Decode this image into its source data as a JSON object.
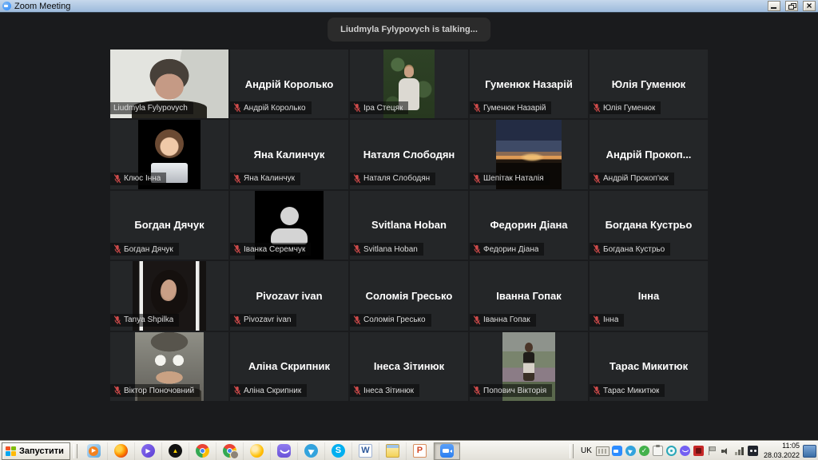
{
  "window": {
    "title": "Zoom Meeting",
    "controls": {
      "minimize": "minimize",
      "restore": "restore",
      "close": "close"
    }
  },
  "toast": {
    "text": "Liudmyla Fylypovych is talking..."
  },
  "meeting": {
    "participants": [
      {
        "label": "Liudmyla Fylypovych",
        "type": "video",
        "avatar": "liudmyla",
        "muted": false,
        "active": true
      },
      {
        "label": "Андрій Королько",
        "type": "text",
        "display_name": "Андрій Королько",
        "muted": true
      },
      {
        "label": "Іра Стецяк",
        "type": "avatar",
        "avatar": "ira",
        "muted": true
      },
      {
        "label": "Гуменюк Назарій",
        "type": "text",
        "display_name": "Гуменюк Назарій",
        "muted": true
      },
      {
        "label": "Юлія Гуменюк",
        "type": "text",
        "display_name": "Юлія Гуменюк",
        "muted": true
      },
      {
        "label": "Клюс Інна",
        "type": "avatar",
        "avatar": "klius",
        "muted": true
      },
      {
        "label": "Яна Калинчук",
        "type": "text",
        "display_name": "Яна Калинчук",
        "muted": true
      },
      {
        "label": "Наталя Слободян",
        "type": "text",
        "display_name": "Наталя Слободян",
        "muted": true
      },
      {
        "label": "Шепітак Наталія",
        "type": "avatar",
        "avatar": "sunset",
        "muted": true
      },
      {
        "label": "Андрій Прокоп'юк",
        "type": "text",
        "display_name": "Андрій  Прокоп...",
        "muted": true
      },
      {
        "label": "Богдан Дячук",
        "type": "text",
        "display_name": "Богдан Дячук",
        "muted": true
      },
      {
        "label": "Іванка Серемчук",
        "type": "avatar",
        "avatar": "placeholder",
        "muted": true
      },
      {
        "label": "Svitlana Hoban",
        "type": "text",
        "display_name": "Svitlana Hoban",
        "muted": true
      },
      {
        "label": "Федорин Діана",
        "type": "text",
        "display_name": "Федорин Діана",
        "muted": true
      },
      {
        "label": "Богдана Кустрьо",
        "type": "text",
        "display_name": "Богдана Кустрьо",
        "muted": true
      },
      {
        "label": "Tanya Shpilka",
        "type": "avatar",
        "avatar": "tanya",
        "muted": true
      },
      {
        "label": "Pivozavr ivan",
        "type": "text",
        "display_name": "Pivozavr ivan",
        "muted": true
      },
      {
        "label": "Соломія Гресько",
        "type": "text",
        "display_name": "Соломія Гресько",
        "muted": true
      },
      {
        "label": "Іванна Гопак",
        "type": "text",
        "display_name": "Іванна Гопак",
        "muted": true
      },
      {
        "label": "Інна",
        "type": "text",
        "display_name": "Інна",
        "muted": true
      },
      {
        "label": "Віктор Поночовний",
        "type": "avatar",
        "avatar": "viktor",
        "muted": true
      },
      {
        "label": "Аліна Скрипник",
        "type": "text",
        "display_name": "Аліна Скрипник",
        "muted": true
      },
      {
        "label": "Інеса Зітинюк",
        "type": "text",
        "display_name": "Інеса Зітинюк",
        "muted": true
      },
      {
        "label": "Попович Вікторія",
        "type": "avatar",
        "avatar": "popovych",
        "muted": true
      },
      {
        "label": "Тарас Микитюк",
        "type": "text",
        "display_name": "Тарас Микитюк",
        "muted": true
      }
    ]
  },
  "taskbar": {
    "start_label": "Запустити",
    "apps": [
      {
        "id": "wmp",
        "name": "windows-media-player"
      },
      {
        "id": "firefox",
        "name": "firefox"
      },
      {
        "id": "kmplayer",
        "name": "kmplayer"
      },
      {
        "id": "aimp",
        "name": "aimp"
      },
      {
        "id": "chrome",
        "name": "google-chrome"
      },
      {
        "id": "chromeprofile",
        "name": "google-chrome-profile"
      },
      {
        "id": "canary",
        "name": "chrome-canary"
      },
      {
        "id": "viber",
        "name": "viber"
      },
      {
        "id": "telegram",
        "name": "telegram"
      },
      {
        "id": "skype",
        "name": "skype"
      },
      {
        "id": "word",
        "name": "ms-word"
      },
      {
        "id": "fileman",
        "name": "file-manager"
      },
      {
        "id": "ppt",
        "name": "ms-powerpoint"
      },
      {
        "id": "zoomapp",
        "name": "zoom",
        "active": true
      }
    ],
    "language": "UK",
    "tray_icons": [
      {
        "id": "zoom",
        "name": "zoom-tray"
      },
      {
        "id": "telegram",
        "name": "telegram-tray"
      },
      {
        "id": "check",
        "name": "antivirus-check-tray"
      },
      {
        "id": "clip",
        "name": "clipboard-tray"
      },
      {
        "id": "eye",
        "name": "eset-tray"
      },
      {
        "id": "viber",
        "name": "viber-tray"
      },
      {
        "id": "red",
        "name": "red-utility-tray"
      },
      {
        "id": "flag",
        "name": "flag-tray"
      },
      {
        "id": "volume",
        "name": "volume-tray"
      },
      {
        "id": "network",
        "name": "network-signal-tray"
      },
      {
        "id": "dark",
        "name": "messenger-tray"
      }
    ],
    "clock": {
      "time": "11:05",
      "date": "28.03.2022"
    }
  },
  "colors": {
    "active_speaker_border": "#a8cc3f",
    "muted_mic_red": "#d04b4b",
    "titlebar_blue": "#9cbadb",
    "taskbar_bg": "#e2e0d8",
    "tile_bg": "#242628",
    "page_bg": "#1a1b1d"
  }
}
